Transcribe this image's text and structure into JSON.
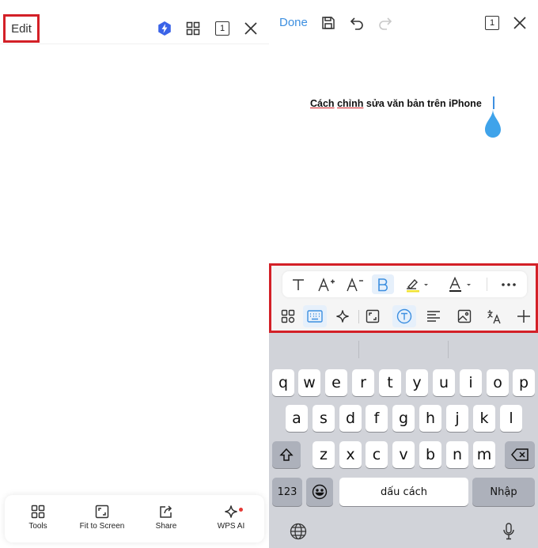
{
  "left": {
    "edit_label": "Edit",
    "topbar_icons": [
      "ai-spark-badge-icon",
      "grid-icon",
      "page-count-icon",
      "close-icon"
    ],
    "page_badge": "1",
    "bottom_bar": [
      {
        "label": "Tools",
        "icon": "tools-grid-icon"
      },
      {
        "label": "Fit to Screen",
        "icon": "fit-screen-icon"
      },
      {
        "label": "Share",
        "icon": "share-icon"
      },
      {
        "label": "WPS AI",
        "icon": "wps-ai-sparkle-icon"
      }
    ]
  },
  "right": {
    "done_label": "Done",
    "page_badge": "1",
    "document_text": {
      "part1": "Cách",
      "part2": "chỉnh",
      "part3": " sửa văn bản trên iPhone"
    },
    "format_toolbar": [
      "text-style-icon",
      "font-increase-icon",
      "font-decrease-icon",
      "bold-icon",
      "highlight-icon",
      "font-color-icon",
      "more-icon"
    ],
    "insert_toolbar": [
      "apps-icon",
      "keyboard-icon",
      "ai-sparkle-icon",
      "fullscreen-icon",
      "text-box-icon",
      "align-icon",
      "image-icon",
      "translate-icon",
      "add-icon"
    ]
  },
  "keyboard": {
    "row1": [
      "q",
      "w",
      "e",
      "r",
      "t",
      "y",
      "u",
      "i",
      "o",
      "p"
    ],
    "row2": [
      "a",
      "s",
      "d",
      "f",
      "g",
      "h",
      "j",
      "k",
      "l"
    ],
    "row3": [
      "z",
      "x",
      "c",
      "v",
      "b",
      "n",
      "m"
    ],
    "numbers_key": "123",
    "space_label": "dấu cách",
    "return_label": "Nhập"
  },
  "colors": {
    "highlight_frame": "#d32027",
    "accent_blue": "#3d8fe0",
    "keyboard_bg": "#d1d3d9"
  }
}
